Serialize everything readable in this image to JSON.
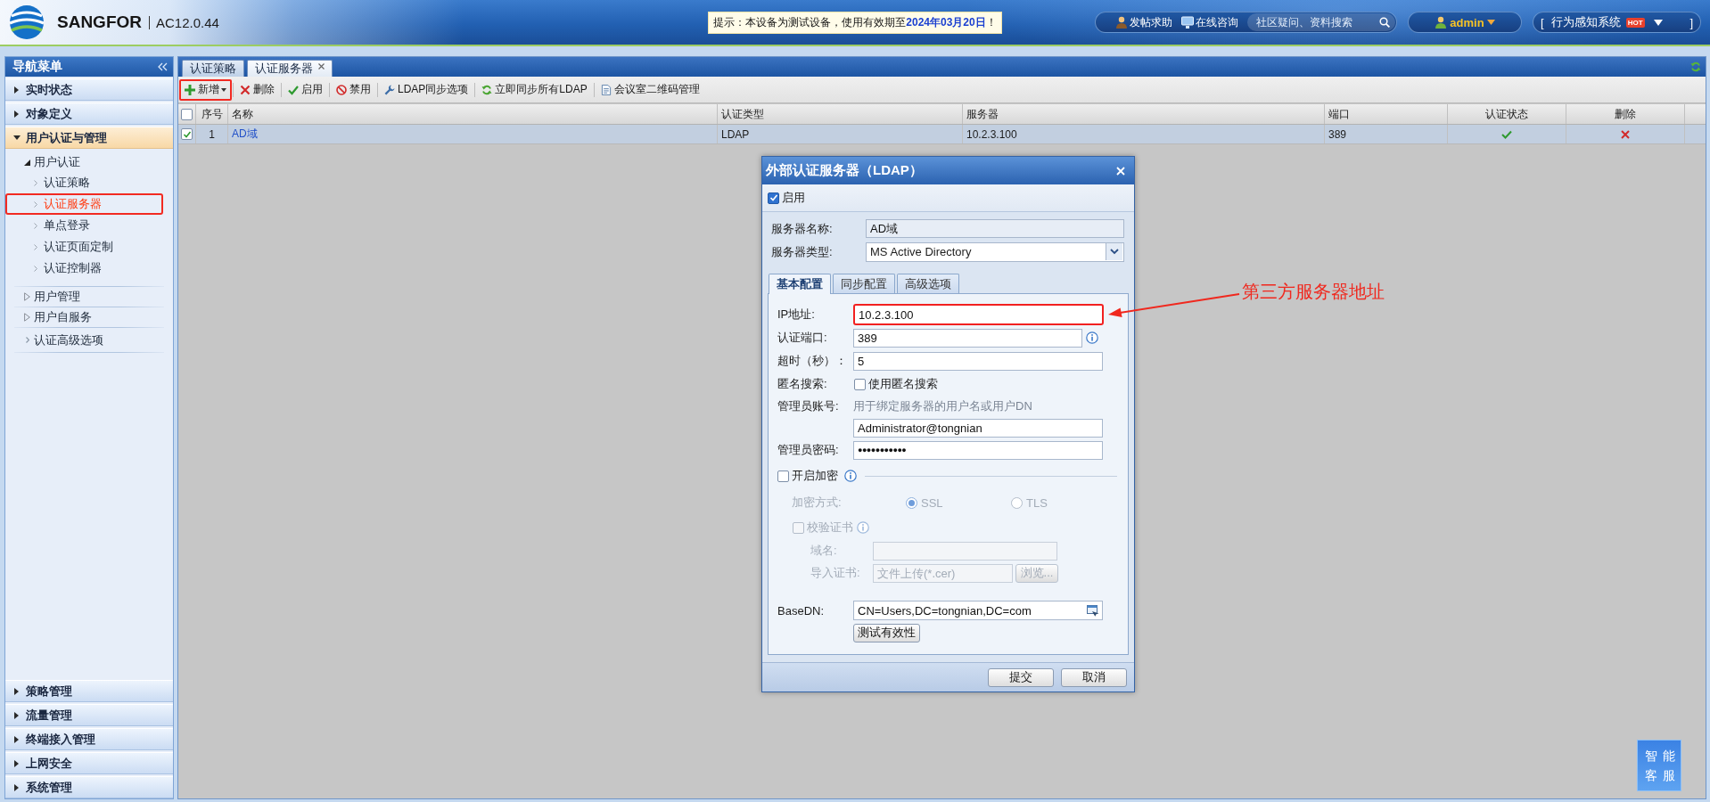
{
  "header": {
    "brand": "SANGFOR",
    "version": "AC12.0.44",
    "notice": "提示：本设备为测试设备，使用有效期至**2024年03月20日**！",
    "links": [
      {
        "kind": "help",
        "label": "发帖求助"
      },
      {
        "kind": "chat",
        "label": "在线咨询"
      }
    ],
    "search": {
      "placeholder": "社区疑问、资料搜索"
    },
    "user": {
      "name": "admin"
    },
    "system": {
      "open": "[",
      "label": "行为感知系统",
      "badge": "HOT",
      "close": "]"
    }
  },
  "sidebar": {
    "title": "导航菜单",
    "sections": [
      {
        "label": "实时状态",
        "expanded": false
      },
      {
        "label": "对象定义",
        "expanded": false
      },
      {
        "label": "用户认证与管理",
        "expanded": true,
        "children": [
          {
            "kind": "group",
            "label": "用户认证",
            "expanded": true,
            "children": [
              {
                "label": "认证策略",
                "selected": false,
                "highlight": false
              },
              {
                "label": "认证服务器",
                "selected": true,
                "highlight": true
              },
              {
                "label": "单点登录",
                "selected": false,
                "highlight": false
              },
              {
                "label": "认证页面定制",
                "selected": false,
                "highlight": false
              },
              {
                "label": "认证控制器",
                "selected": false,
                "highlight": false
              }
            ]
          },
          {
            "kind": "group",
            "label": "用户管理",
            "expanded": false
          },
          {
            "kind": "group",
            "label": "用户自服务",
            "expanded": false
          },
          {
            "kind": "link",
            "label": "认证高级选项",
            "selected": false
          }
        ]
      },
      {
        "label": "策略管理",
        "expanded": false
      },
      {
        "label": "流量管理",
        "expanded": false
      },
      {
        "label": "终端接入管理",
        "expanded": false
      },
      {
        "label": "上网安全",
        "expanded": false
      },
      {
        "label": "系统管理",
        "expanded": false
      }
    ]
  },
  "tabs": [
    {
      "label": "认证策略",
      "selected": false,
      "closable": false
    },
    {
      "label": "认证服务器",
      "selected": true,
      "closable": true
    }
  ],
  "toolbar": [
    {
      "kind": "add",
      "label": "新增",
      "dropdown": true,
      "highlight": true
    },
    {
      "kind": "delete",
      "label": "删除",
      "dropdown": false,
      "highlight": false
    },
    {
      "kind": "enable",
      "label": "启用",
      "dropdown": false,
      "highlight": false
    },
    {
      "kind": "disable",
      "label": "禁用",
      "dropdown": false,
      "highlight": false
    },
    {
      "kind": "wrench",
      "label": "LDAP同步选项",
      "dropdown": false,
      "highlight": false
    },
    {
      "kind": "sync",
      "label": "立即同步所有LDAP",
      "dropdown": false,
      "highlight": false
    },
    {
      "kind": "qrcode",
      "label": "会议室二维码管理",
      "dropdown": false,
      "highlight": false
    }
  ],
  "table": {
    "all_checked": false,
    "columns": [
      "序号",
      "名称",
      "认证类型",
      "服务器",
      "端口",
      "认证状态",
      "删除"
    ],
    "rows": [
      {
        "selected": true,
        "checked": true,
        "index": "1",
        "name": "AD域",
        "type": "LDAP",
        "server": "10.2.3.100",
        "port": "389",
        "status_ok": true
      }
    ]
  },
  "dialog": {
    "title": "外部认证服务器（LDAP）",
    "enable": {
      "label": "启用",
      "checked": true
    },
    "fields": [
      {
        "kind": "readonly",
        "label": "服务器名称:",
        "value": "AD域"
      },
      {
        "kind": "select",
        "label": "服务器类型:",
        "value": "MS Active Directory"
      }
    ],
    "tabs": [
      {
        "label": "基本配置",
        "selected": true
      },
      {
        "label": "同步配置",
        "selected": false
      },
      {
        "label": "高级选项",
        "selected": false
      }
    ],
    "rows": [
      {
        "kind": "text",
        "label": "IP地址:",
        "value": "10.2.3.100",
        "highlight": true,
        "info": false
      },
      {
        "kind": "text",
        "label": "认证端口:",
        "value": "389",
        "highlight": false,
        "info": true
      },
      {
        "kind": "text",
        "label": "超时（秒）：",
        "value": "5",
        "highlight": false,
        "info": false
      },
      {
        "kind": "checkbox",
        "label": "匿名搜索:",
        "option": "使用匿名搜索",
        "checked": false
      },
      {
        "kind": "account",
        "label": "管理员账号:",
        "hint": "用于绑定服务器的用户名或用户DN",
        "value": "Administrator@tongnian"
      },
      {
        "kind": "password",
        "label": "管理员密码:",
        "value": "●●●●●●●●●●●",
        "highlight": false,
        "info": false
      }
    ],
    "encryption": {
      "label": "开启加密",
      "checked": false,
      "info": true,
      "method_label": "加密方式:",
      "methods": [
        {
          "label": "SSL",
          "selected": true
        },
        {
          "label": "TLS",
          "selected": false
        }
      ],
      "verify": {
        "label": "校验证书",
        "checked": false,
        "info": true
      },
      "domain_label": "域名:",
      "cert_label": "导入证书:",
      "cert_placeholder": "文件上传(*.cer)",
      "browse": "浏览..."
    },
    "basedn": {
      "label": "BaseDN:",
      "value": "CN=Users,DC=tongnian,DC=com",
      "test": "测试有效性"
    },
    "buttons": [
      "提交",
      "取消"
    ]
  },
  "annotation": {
    "label": "第三方服务器地址"
  },
  "assistant": {
    "label": "智能客服"
  }
}
